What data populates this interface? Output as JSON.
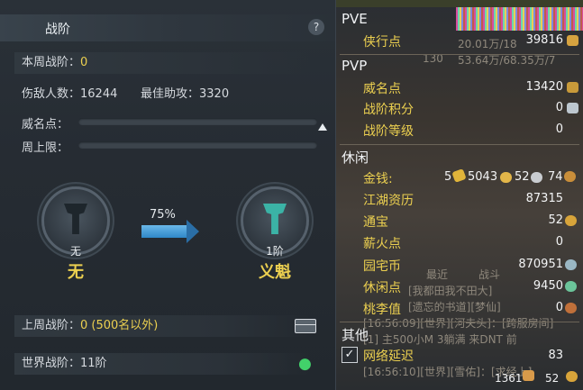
{
  "panel": {
    "title": "战阶",
    "help": "?",
    "week_label": "本周战阶：",
    "week_value": "0",
    "kills_label": "伤敌人数：",
    "kills_value": "16244",
    "assist_label": "最佳助攻：",
    "assist_value": "3320",
    "fame_label": "威名点：",
    "cap_label": "周上限：",
    "current_level": "无",
    "current_name": "无",
    "progress_percent": "75%",
    "next_level": "1阶",
    "next_name": "义魁",
    "last_week_label": "上周战阶：",
    "last_week_value": "0 (500名以外)",
    "world_label": "世界战阶：",
    "world_value": "11阶"
  },
  "stats": {
    "pve_header": "PVE",
    "pve": [
      {
        "label": "侠行点",
        "value": "39816"
      }
    ],
    "pvp_header": "PVP",
    "pvp": [
      {
        "label": "威名点",
        "value": "13420"
      },
      {
        "label": "战阶积分",
        "value": "0"
      },
      {
        "label": "战阶等级",
        "value": "0"
      }
    ],
    "leisure_header": "休闲",
    "money_label": "金钱:",
    "money": [
      "5",
      "5043",
      "52",
      "74"
    ],
    "leisure": [
      {
        "label": "江湖资历",
        "value": "87315"
      },
      {
        "label": "通宝",
        "value": "52"
      },
      {
        "label": "薪火点",
        "value": "0"
      },
      {
        "label": "园宅币",
        "value": "870951"
      },
      {
        "label": "休闲点",
        "value": "9450"
      },
      {
        "label": "桃李值",
        "value": "0"
      }
    ],
    "other_header": "其他",
    "latency_label": "网络延迟",
    "latency_value": "83",
    "bottom_left": "1361",
    "bottom_right": "52"
  },
  "background_text": {
    "b1": "20.01万/18",
    "b2": "130",
    "b3": "53.64万/68.35万/7",
    "b4": "最近",
    "b5": "战斗",
    "b6": "[我都田我不田大]",
    "b7": "[遗忘的书道][梦仙]",
    "b8": "[16:56:09][世界][河夫头]：[跨服房间]",
    "b9": "[1] 主500小M 3躺满 来DNT 前",
    "b10": "[16:56:10][世界][雪佑]：[求经上]"
  },
  "colors": {
    "accent_yellow": "#ecd050",
    "progress_blue": "#2f88c8",
    "map_pin_green": "#42d16a"
  }
}
